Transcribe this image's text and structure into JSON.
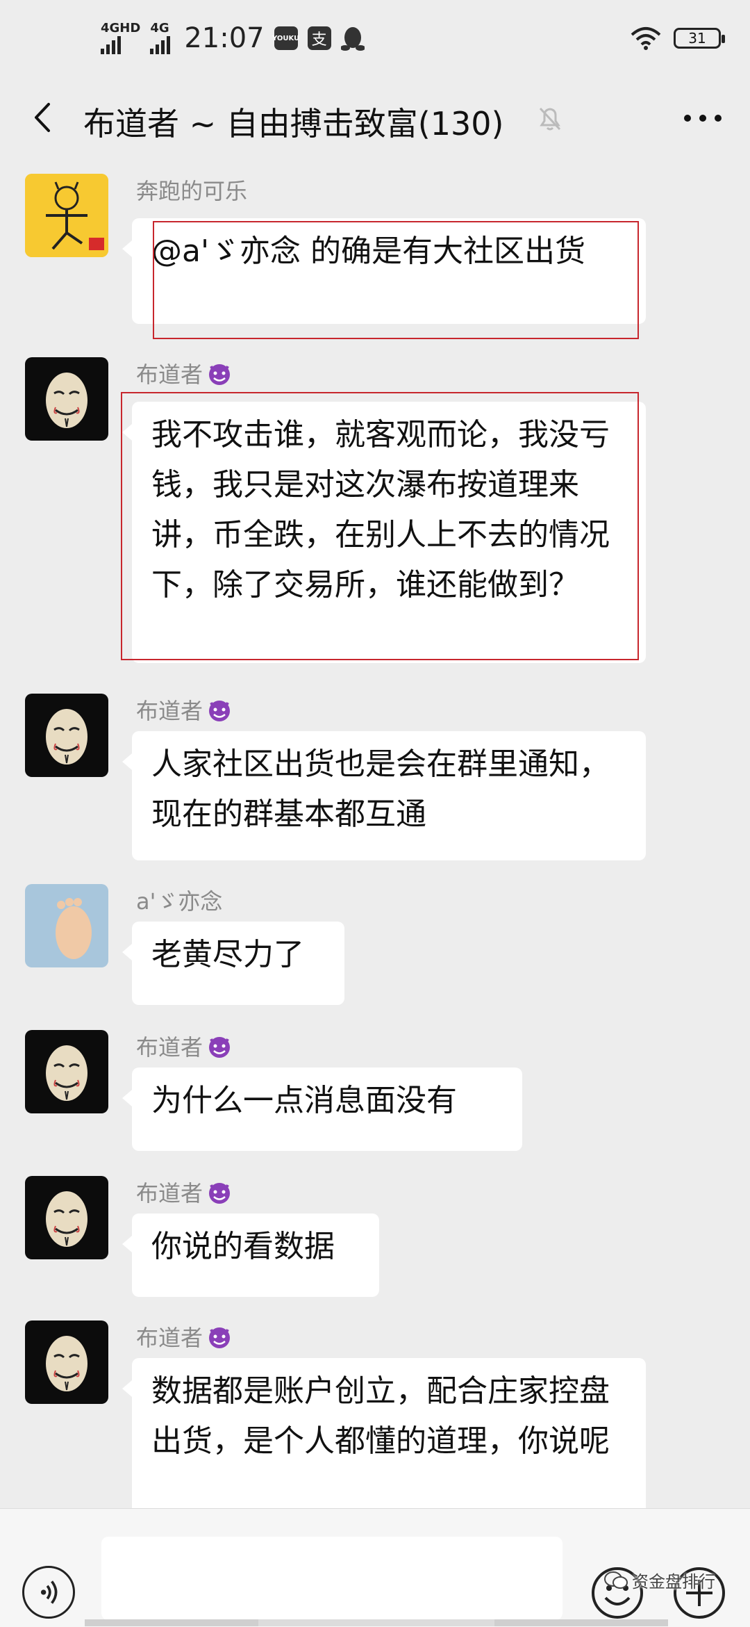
{
  "status_bar": {
    "net1_top": "4GHD",
    "net2_top": "4G",
    "time": "21:07",
    "youku_label": "YOUKU",
    "alipay_glyph": "支",
    "battery": "31"
  },
  "header": {
    "title": "布道者 ~ 自由搏击致富(130)"
  },
  "messages": [
    {
      "sender": "奔跑的可乐",
      "text": "@a'ゞ亦念 的确是有大社区出货",
      "avatar": "cartoon"
    },
    {
      "sender": "布道者",
      "text": "我不攻击谁，就客观而论，我没亏钱，我只是对这次瀑布按道理来讲，币全跌，在别人上不去的情况下，除了交易所，谁还能做到？",
      "avatar": "mask"
    },
    {
      "sender": "布道者",
      "text": "人家社区出货也是会在群里通知，现在的群基本都互通",
      "avatar": "mask"
    },
    {
      "sender": "a'ゞ亦念",
      "text": "老黄尽力了",
      "avatar": "baby-foot"
    },
    {
      "sender": "布道者",
      "text": "为什么一点消息面没有",
      "avatar": "mask"
    },
    {
      "sender": "布道者",
      "text": "你说的看数据",
      "avatar": "mask"
    },
    {
      "sender": "布道者",
      "text": "数据都是账户创立，配合庄家控盘出货，是个人都懂的道理，你说呢",
      "avatar": "mask"
    }
  ],
  "watermark": {
    "text": "资金盘排行"
  },
  "colors": {
    "background": "#ededed",
    "bubble": "#ffffff",
    "highlight_border": "#c7262d",
    "sender_name": "#8a8a8a"
  }
}
